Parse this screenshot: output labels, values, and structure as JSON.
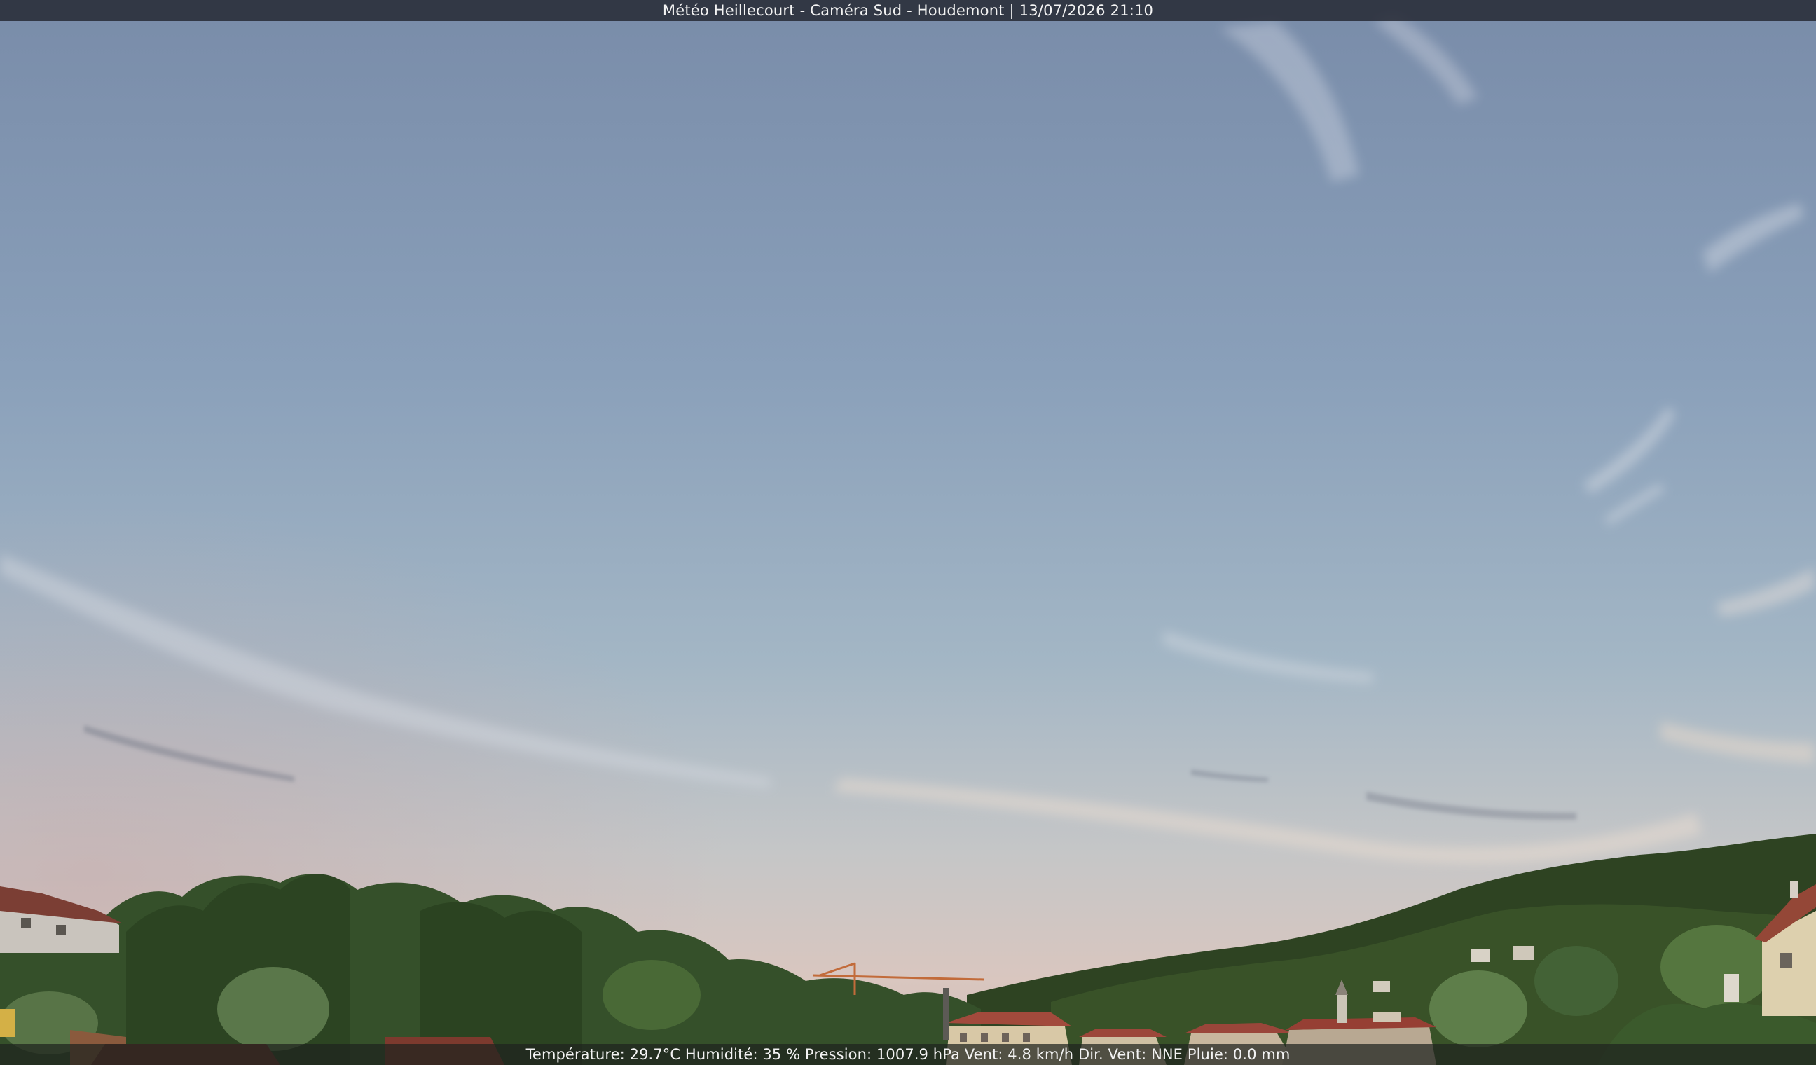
{
  "webcam": {
    "title": "Météo Heillecourt - Caméra Sud - Houdemont | 13/07/2026 21:10",
    "weather_line": "Température: 29.7°C  Humidité: 35 % Pression: 1007.9 hPa Vent: 4.8 km/h Dir. Vent: NNE Pluie: 0.0 mm"
  },
  "colors": {
    "sky_top": "#7b8fae",
    "sky_mid": "#96abc0",
    "sky_horizon": "#d8c9c3",
    "hills": "#2f4424",
    "trees": "#3d5a2c",
    "roofs": "#9a4a3a"
  }
}
